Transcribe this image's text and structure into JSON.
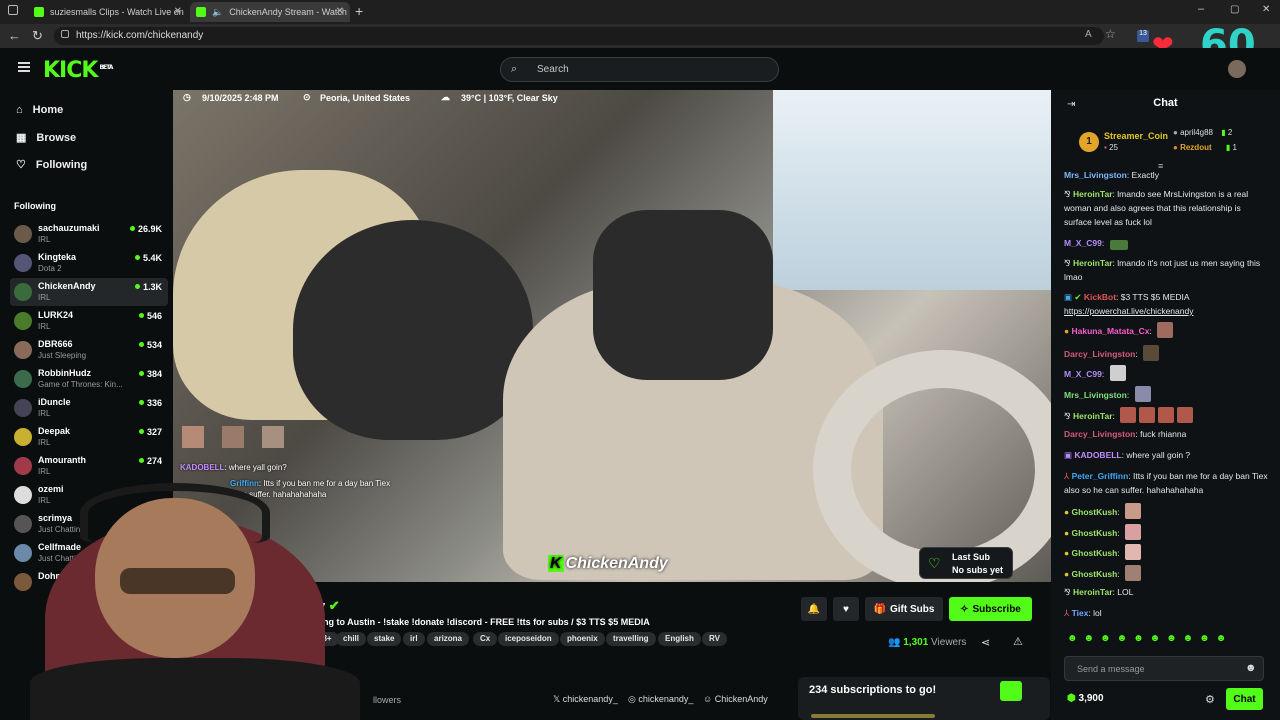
{
  "browser": {
    "tabs": [
      {
        "title": "suziesmalls Clips - Watch Live on"
      },
      {
        "title": "ChickenAndy Stream - Watch"
      }
    ],
    "url": "https://kick.com/chickenandy",
    "overlay_counter": "60",
    "badge_count": "13"
  },
  "header": {
    "logo": "KICK",
    "logo_badge": "BETA",
    "search_placeholder": "Search"
  },
  "sidebar": {
    "nav": [
      {
        "label": "Home",
        "icon": "home-icon"
      },
      {
        "label": "Browse",
        "icon": "browse-icon"
      },
      {
        "label": "Following",
        "icon": "heart-icon"
      }
    ],
    "following_title": "Following",
    "following": [
      {
        "name": "sachauzumaki",
        "category": "IRL",
        "viewers": "26.9K"
      },
      {
        "name": "Kingteka",
        "category": "Dota 2",
        "viewers": "5.4K"
      },
      {
        "name": "ChickenAndy",
        "category": "IRL",
        "viewers": "1.3K"
      },
      {
        "name": "LURK24",
        "category": "IRL",
        "viewers": "546"
      },
      {
        "name": "DBR666",
        "category": "Just Sleeping",
        "viewers": "534"
      },
      {
        "name": "RobbinHudz",
        "category": "Game of Thrones: Kin...",
        "viewers": "384"
      },
      {
        "name": "iDuncle",
        "category": "IRL",
        "viewers": "336"
      },
      {
        "name": "Deepak",
        "category": "IRL",
        "viewers": "327"
      },
      {
        "name": "Amouranth",
        "category": "IRL",
        "viewers": "274"
      },
      {
        "name": "ozemi",
        "category": "IRL",
        "viewers": ""
      },
      {
        "name": "scrimya",
        "category": "Just Chatting",
        "viewers": ""
      },
      {
        "name": "Cellfmade",
        "category": "Just Chatting",
        "viewers": ""
      },
      {
        "name": "Dohmo",
        "category": "",
        "viewers": ""
      }
    ]
  },
  "video": {
    "datetime": "9/10/2025 2:48 PM",
    "location": "Peoria, United States",
    "weather": "39°C | 103°F, Clear Sky",
    "watermark": "ChickenAndy",
    "last_sub_title": "Last Sub",
    "last_sub_value": "No subs yet",
    "overlay_chat": [
      {
        "user": "KADOBELL",
        "text": "where yall goin?"
      },
      {
        "user": "Griffinn",
        "text": "Itts if you ban me for a day ban Tiex"
      },
      {
        "user": "",
        "text": "an suffer. hahahahahaha"
      }
    ]
  },
  "stream": {
    "channel_partial": "dy",
    "title": "oving to Austin - !stake !donate !discord - FREE !tts for subs / $3 TTS $5 MEDIA",
    "tags": [
      "18+",
      "chill",
      "stake",
      "irl",
      "arizona",
      "Cx",
      "iceposeidon",
      "phoenix",
      "travelling",
      "English",
      "RV"
    ],
    "gift_subs_label": "Gift Subs",
    "subscribe_label": "Subscribe",
    "viewers": "1,301",
    "viewers_label": "Viewers",
    "followers_label": "llowers",
    "socials": [
      "chickenandy_",
      "chickenandy_",
      "ChickenAndy"
    ],
    "subs_goal": "234 subscriptions to go!"
  },
  "chat": {
    "title": "Chat",
    "top": [
      {
        "name": "Streamer_Coin",
        "value": "25"
      },
      {
        "name": "april4g88",
        "value": "2"
      },
      {
        "name": "Rezdout",
        "value": "1"
      }
    ],
    "messages": [
      {
        "user": "Mrs_Livingston",
        "text": "Exactly",
        "color": "#7fb6ff"
      },
      {
        "user": "HeroinTar",
        "text": "lmando see MrsLivingston is a real woman and also agrees that this relationship is surface level as fuck lol",
        "color": "#9be36b"
      },
      {
        "user": "M_X_C99",
        "text": "",
        "color": "#b48cff"
      },
      {
        "user": "HeroinTar",
        "text": "lmando it's not just us men saying this lmao",
        "color": "#9be36b"
      },
      {
        "user": "KickBot",
        "text": "$3 TTS $5 MEDIA",
        "color": "#e05555"
      },
      {
        "user": "",
        "text": "https://powerchat.live/chickenandy",
        "color": "#ffffff"
      },
      {
        "user": "Hakuna_Matata_Cx",
        "text": "",
        "color": "#ff5ad1"
      },
      {
        "user": "Darcy_Livingston",
        "text": "",
        "color": "#d85a7c"
      },
      {
        "user": "M_X_C99",
        "text": "",
        "color": "#b48cff"
      },
      {
        "user": "Mrs_Livingston",
        "text": "",
        "color": "#7fe07f"
      },
      {
        "user": "HeroinTar",
        "text": "",
        "color": "#9be36b"
      },
      {
        "user": "Darcy_Livingston",
        "text": "fuck rhianna",
        "color": "#d85a7c"
      },
      {
        "user": "KADOBELL",
        "text": "where yall goin ?",
        "color": "#c38cff"
      },
      {
        "user": "Peter_Griffinn",
        "text": "Itts if you ban me for a day ban Tiex also so he can suffer. hahahahahaha",
        "color": "#3fa9f5"
      },
      {
        "user": "GhostKush",
        "text": "",
        "color": "#9be36b"
      },
      {
        "user": "GhostKush",
        "text": "",
        "color": "#9be36b"
      },
      {
        "user": "GhostKush",
        "text": "",
        "color": "#9be36b"
      },
      {
        "user": "GhostKush",
        "text": "",
        "color": "#9be36b"
      },
      {
        "user": "HeroinTar",
        "text": "LOL",
        "color": "#9be36b"
      },
      {
        "user": "Tiex",
        "text": "lol",
        "color": "#6fa8ff"
      }
    ],
    "input_placeholder": "Send a message",
    "points": "3,900",
    "send_label": "Chat"
  },
  "colors": {
    "accent": "#53fc18",
    "background": "#0b0e0f"
  }
}
